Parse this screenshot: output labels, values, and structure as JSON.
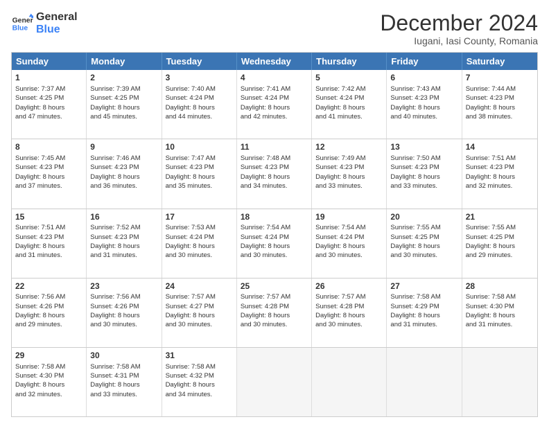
{
  "logo": {
    "line1": "General",
    "line2": "Blue"
  },
  "title": "December 2024",
  "location": "Iugani, Iasi County, Romania",
  "header_days": [
    "Sunday",
    "Monday",
    "Tuesday",
    "Wednesday",
    "Thursday",
    "Friday",
    "Saturday"
  ],
  "weeks": [
    [
      {
        "day": "1",
        "lines": [
          "Sunrise: 7:37 AM",
          "Sunset: 4:25 PM",
          "Daylight: 8 hours",
          "and 47 minutes."
        ]
      },
      {
        "day": "2",
        "lines": [
          "Sunrise: 7:39 AM",
          "Sunset: 4:25 PM",
          "Daylight: 8 hours",
          "and 45 minutes."
        ]
      },
      {
        "day": "3",
        "lines": [
          "Sunrise: 7:40 AM",
          "Sunset: 4:24 PM",
          "Daylight: 8 hours",
          "and 44 minutes."
        ]
      },
      {
        "day": "4",
        "lines": [
          "Sunrise: 7:41 AM",
          "Sunset: 4:24 PM",
          "Daylight: 8 hours",
          "and 42 minutes."
        ]
      },
      {
        "day": "5",
        "lines": [
          "Sunrise: 7:42 AM",
          "Sunset: 4:24 PM",
          "Daylight: 8 hours",
          "and 41 minutes."
        ]
      },
      {
        "day": "6",
        "lines": [
          "Sunrise: 7:43 AM",
          "Sunset: 4:23 PM",
          "Daylight: 8 hours",
          "and 40 minutes."
        ]
      },
      {
        "day": "7",
        "lines": [
          "Sunrise: 7:44 AM",
          "Sunset: 4:23 PM",
          "Daylight: 8 hours",
          "and 38 minutes."
        ]
      }
    ],
    [
      {
        "day": "8",
        "lines": [
          "Sunrise: 7:45 AM",
          "Sunset: 4:23 PM",
          "Daylight: 8 hours",
          "and 37 minutes."
        ]
      },
      {
        "day": "9",
        "lines": [
          "Sunrise: 7:46 AM",
          "Sunset: 4:23 PM",
          "Daylight: 8 hours",
          "and 36 minutes."
        ]
      },
      {
        "day": "10",
        "lines": [
          "Sunrise: 7:47 AM",
          "Sunset: 4:23 PM",
          "Daylight: 8 hours",
          "and 35 minutes."
        ]
      },
      {
        "day": "11",
        "lines": [
          "Sunrise: 7:48 AM",
          "Sunset: 4:23 PM",
          "Daylight: 8 hours",
          "and 34 minutes."
        ]
      },
      {
        "day": "12",
        "lines": [
          "Sunrise: 7:49 AM",
          "Sunset: 4:23 PM",
          "Daylight: 8 hours",
          "and 33 minutes."
        ]
      },
      {
        "day": "13",
        "lines": [
          "Sunrise: 7:50 AM",
          "Sunset: 4:23 PM",
          "Daylight: 8 hours",
          "and 33 minutes."
        ]
      },
      {
        "day": "14",
        "lines": [
          "Sunrise: 7:51 AM",
          "Sunset: 4:23 PM",
          "Daylight: 8 hours",
          "and 32 minutes."
        ]
      }
    ],
    [
      {
        "day": "15",
        "lines": [
          "Sunrise: 7:51 AM",
          "Sunset: 4:23 PM",
          "Daylight: 8 hours",
          "and 31 minutes."
        ]
      },
      {
        "day": "16",
        "lines": [
          "Sunrise: 7:52 AM",
          "Sunset: 4:23 PM",
          "Daylight: 8 hours",
          "and 31 minutes."
        ]
      },
      {
        "day": "17",
        "lines": [
          "Sunrise: 7:53 AM",
          "Sunset: 4:24 PM",
          "Daylight: 8 hours",
          "and 30 minutes."
        ]
      },
      {
        "day": "18",
        "lines": [
          "Sunrise: 7:54 AM",
          "Sunset: 4:24 PM",
          "Daylight: 8 hours",
          "and 30 minutes."
        ]
      },
      {
        "day": "19",
        "lines": [
          "Sunrise: 7:54 AM",
          "Sunset: 4:24 PM",
          "Daylight: 8 hours",
          "and 30 minutes."
        ]
      },
      {
        "day": "20",
        "lines": [
          "Sunrise: 7:55 AM",
          "Sunset: 4:25 PM",
          "Daylight: 8 hours",
          "and 30 minutes."
        ]
      },
      {
        "day": "21",
        "lines": [
          "Sunrise: 7:55 AM",
          "Sunset: 4:25 PM",
          "Daylight: 8 hours",
          "and 29 minutes."
        ]
      }
    ],
    [
      {
        "day": "22",
        "lines": [
          "Sunrise: 7:56 AM",
          "Sunset: 4:26 PM",
          "Daylight: 8 hours",
          "and 29 minutes."
        ]
      },
      {
        "day": "23",
        "lines": [
          "Sunrise: 7:56 AM",
          "Sunset: 4:26 PM",
          "Daylight: 8 hours",
          "and 30 minutes."
        ]
      },
      {
        "day": "24",
        "lines": [
          "Sunrise: 7:57 AM",
          "Sunset: 4:27 PM",
          "Daylight: 8 hours",
          "and 30 minutes."
        ]
      },
      {
        "day": "25",
        "lines": [
          "Sunrise: 7:57 AM",
          "Sunset: 4:28 PM",
          "Daylight: 8 hours",
          "and 30 minutes."
        ]
      },
      {
        "day": "26",
        "lines": [
          "Sunrise: 7:57 AM",
          "Sunset: 4:28 PM",
          "Daylight: 8 hours",
          "and 30 minutes."
        ]
      },
      {
        "day": "27",
        "lines": [
          "Sunrise: 7:58 AM",
          "Sunset: 4:29 PM",
          "Daylight: 8 hours",
          "and 31 minutes."
        ]
      },
      {
        "day": "28",
        "lines": [
          "Sunrise: 7:58 AM",
          "Sunset: 4:30 PM",
          "Daylight: 8 hours",
          "and 31 minutes."
        ]
      }
    ],
    [
      {
        "day": "29",
        "lines": [
          "Sunrise: 7:58 AM",
          "Sunset: 4:30 PM",
          "Daylight: 8 hours",
          "and 32 minutes."
        ]
      },
      {
        "day": "30",
        "lines": [
          "Sunrise: 7:58 AM",
          "Sunset: 4:31 PM",
          "Daylight: 8 hours",
          "and 33 minutes."
        ]
      },
      {
        "day": "31",
        "lines": [
          "Sunrise: 7:58 AM",
          "Sunset: 4:32 PM",
          "Daylight: 8 hours",
          "and 34 minutes."
        ]
      },
      null,
      null,
      null,
      null
    ]
  ]
}
